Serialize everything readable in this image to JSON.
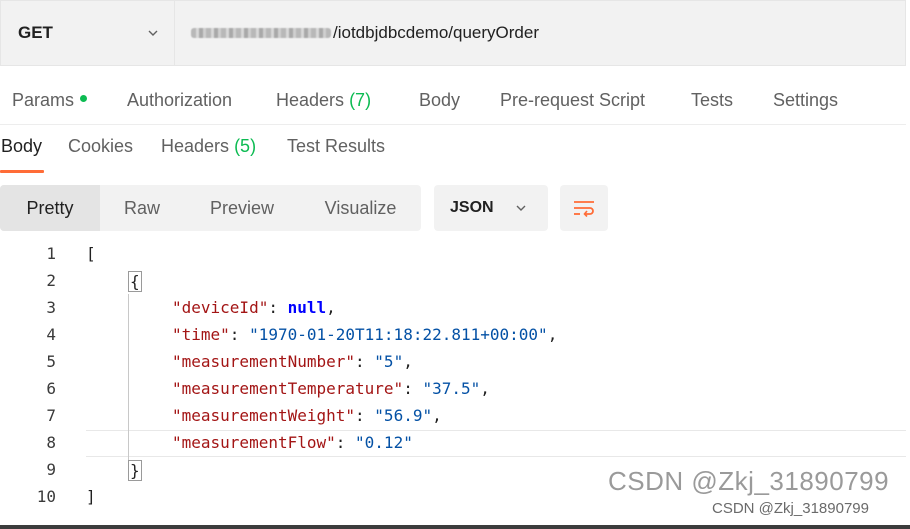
{
  "request": {
    "method": "GET",
    "url_visible": "/iotdbjdbcdemo/queryOrder"
  },
  "request_tabs": [
    {
      "label": "Params",
      "indicator": "dot"
    },
    {
      "label": "Authorization"
    },
    {
      "label": "Headers",
      "count": "(7)"
    },
    {
      "label": "Body"
    },
    {
      "label": "Pre-request Script"
    },
    {
      "label": "Tests"
    },
    {
      "label": "Settings"
    }
  ],
  "response_tabs": [
    {
      "label": "Body",
      "active": true
    },
    {
      "label": "Cookies"
    },
    {
      "label": "Headers",
      "count": "(5)"
    },
    {
      "label": "Test Results"
    }
  ],
  "view_modes": [
    "Pretty",
    "Raw",
    "Preview",
    "Visualize"
  ],
  "active_view": "Pretty",
  "format": "JSON",
  "code_lines": [
    {
      "n": "1",
      "text": "["
    },
    {
      "n": "2",
      "text": "{"
    },
    {
      "n": "3",
      "key": "\"deviceId\"",
      "value": "null",
      "value_type": "keyword",
      "trail": ","
    },
    {
      "n": "4",
      "key": "\"time\"",
      "value": "\"1970-01-20T11:18:22.811+00:00\"",
      "value_type": "string",
      "trail": ","
    },
    {
      "n": "5",
      "key": "\"measurementNumber\"",
      "value": "\"5\"",
      "value_type": "string",
      "trail": ","
    },
    {
      "n": "6",
      "key": "\"measurementTemperature\"",
      "value": "\"37.5\"",
      "value_type": "string",
      "trail": ","
    },
    {
      "n": "7",
      "key": "\"measurementWeight\"",
      "value": "\"56.9\"",
      "value_type": "string",
      "trail": ","
    },
    {
      "n": "8",
      "key": "\"measurementFlow\"",
      "value": "\"0.12\"",
      "value_type": "string",
      "trail": ""
    },
    {
      "n": "9",
      "text": "}"
    },
    {
      "n": "10",
      "text": "]"
    }
  ],
  "watermark": {
    "large": "CSDN @Zkj_31890799",
    "small": "CSDN @Zkj_31890799"
  },
  "colors": {
    "accent": "#ff6c37",
    "status_green": "#0cbb52",
    "json_key": "#a31515",
    "json_string": "#0451a5",
    "json_keyword": "#0000ff"
  }
}
